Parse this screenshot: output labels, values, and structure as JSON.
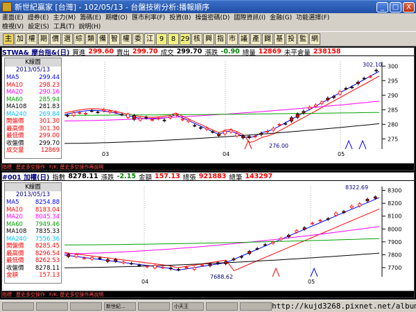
{
  "titlebar": {
    "title": "新世紀贏家 [台灣] - 102/05/13 - 台盤技術分析:播報順序",
    "buttons": [
      "_",
      "□",
      "X"
    ]
  },
  "menus": {
    "row1": [
      "畫面(E)",
      "證券(E)",
      "主力(M)",
      "籌碼(E)",
      "期權(O)",
      "匯市利率(F)",
      "投資(B)",
      "操盤密碼(D)",
      "國際資訊(I)",
      "金融(G)",
      "功能選擇(F)"
    ],
    "row2": [
      "檢視(V)",
      "設定(S)",
      "工具(T)",
      "說明(H)"
    ]
  },
  "toolbar": {
    "items": [
      "主",
      "加",
      "權",
      "期",
      "價",
      "選",
      "綜",
      "類",
      "備",
      "智",
      "權",
      "委",
      "江",
      "9",
      "8",
      "29",
      "核",
      "興",
      "指",
      "市",
      "議",
      "產",
      "闢",
      "基",
      "投",
      "監",
      "網"
    ]
  },
  "panel1": {
    "header": {
      "symbol": "STWA& 摩台指&(日)",
      "bid_label": "買進",
      "bid": "299.60",
      "ask_label": "賣出",
      "ask": "299.70",
      "last_label": "成交",
      "last": "299.70",
      "chg_label": "漲跌",
      "chg": "-0.90",
      "vol_label": "總量",
      "vol": "12869",
      "oi_label": "未平倉量",
      "oi": "238158"
    },
    "side": {
      "title": "K線圖",
      "date": "2013/05/13",
      "rows": [
        {
          "label": "MA5",
          "value": "299.44",
          "color": "#0000ff"
        },
        {
          "label": "MA10",
          "value": "298.23",
          "color": "#ff0000"
        },
        {
          "label": "MA20",
          "value": "290.16",
          "color": "#ff00ff"
        },
        {
          "label": "MA60",
          "value": "285.94",
          "color": "#00a000"
        },
        {
          "label": "MA108",
          "value": "281.83",
          "color": "#000000"
        },
        {
          "label": "MA240",
          "value": "269.84",
          "color": "#00c0ff"
        },
        {
          "label": "開盤價",
          "value": "301.30",
          "color": "#ff0000"
        },
        {
          "label": "最高價",
          "value": "301.30",
          "color": "#ff0000"
        },
        {
          "label": "最低價",
          "value": "299.00",
          "color": "#ff0000"
        },
        {
          "label": "收盤價",
          "value": "299.70",
          "color": "#000000"
        },
        {
          "label": "成交量",
          "value": "12869",
          "color": "#ff0000"
        }
      ]
    },
    "footer": [
      "指標",
      "歷史多空操作",
      "F/K: 歷史多空操作再說明"
    ],
    "chart": {
      "months": [
        "03",
        "04",
        "05"
      ],
      "yticks": [
        "300",
        "295",
        "290",
        "285",
        "280",
        "275"
      ],
      "high_label": "302.10",
      "low_label": "276.00"
    }
  },
  "panel2": {
    "header": {
      "symbol": "#001 加權(日)",
      "idx_label": "指數",
      "idx": "8278.11",
      "chg_label": "漲跌",
      "chg": "-2.15",
      "amt_label": "金額",
      "amt": "157.13",
      "up_label": "總張",
      "up": "921883",
      "cnt_label": "總筆",
      "cnt": "143297"
    },
    "side": {
      "title": "K線圖",
      "date": "2013/05/13",
      "rows": [
        {
          "label": "MA5",
          "value": "8254.88",
          "color": "#0000ff"
        },
        {
          "label": "MA10",
          "value": "8183.04",
          "color": "#ff0000"
        },
        {
          "label": "MA20",
          "value": "8045.34",
          "color": "#ff00ff"
        },
        {
          "label": "MA60",
          "value": "7949.46",
          "color": "#00a000"
        },
        {
          "label": "MA108",
          "value": "7835.33",
          "color": "#000000"
        },
        {
          "label": "MA240",
          "value": "7556.36",
          "color": "#00c0ff"
        },
        {
          "label": "開盤價",
          "value": "8285.45",
          "color": "#ff0000"
        },
        {
          "label": "最高價",
          "value": "8296.54",
          "color": "#ff0000"
        },
        {
          "label": "最低價",
          "value": "8262.53",
          "color": "#ff0000"
        },
        {
          "label": "收盤價",
          "value": "8278.11",
          "color": "#000000"
        },
        {
          "label": "金額",
          "value": "157.13",
          "color": "#ff0000"
        }
      ]
    },
    "footer": [
      "指標",
      "歷史多空操作",
      "F/K: 歷史多空操作再說明"
    ],
    "chart": {
      "months": [
        "04",
        "05"
      ],
      "yticks": [
        "8300",
        "8200",
        "8100",
        "8000",
        "7900",
        "7800",
        "7700"
      ],
      "high_label": "8322.69",
      "low_label": "7688.62"
    }
  },
  "statusbar": {
    "tasks": [
      "",
      "",
      "",
      "新世紀...",
      "",
      "小天王",
      "",
      ""
    ],
    "url": "http://kujd3268.pixnet.net/album"
  }
}
